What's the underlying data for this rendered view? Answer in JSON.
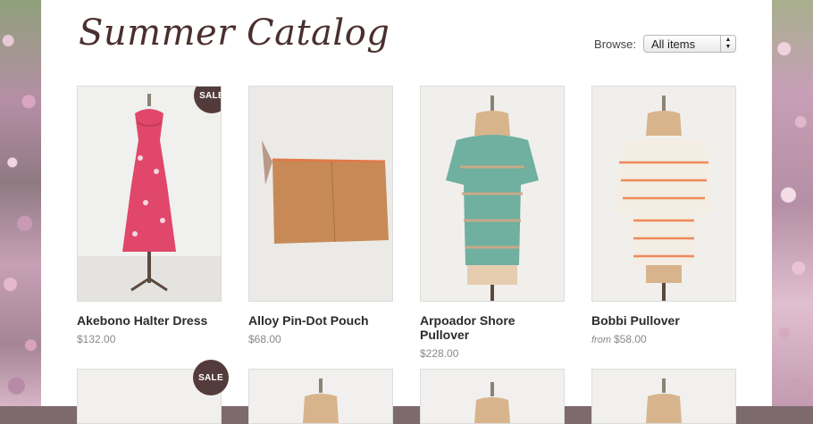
{
  "header": {
    "title": "Summer Catalog"
  },
  "browse": {
    "label": "Browse:",
    "selected": "All items"
  },
  "products": [
    {
      "name": "Akebono Halter Dress",
      "price": "$132.00",
      "from": "",
      "sale": "SALE",
      "icon": "dress-image"
    },
    {
      "name": "Alloy Pin-Dot Pouch",
      "price": "$68.00",
      "from": "",
      "sale": "",
      "icon": "pouch-image"
    },
    {
      "name": "Arpoador Shore Pullover",
      "price": "$228.00",
      "from": "",
      "sale": "",
      "icon": "pullover-image"
    },
    {
      "name": "Bobbi Pullover",
      "price": "$58.00",
      "from": "from",
      "sale": "",
      "icon": "striped-pullover-image"
    }
  ],
  "row2": [
    {
      "sale": "SALE"
    },
    {},
    {},
    {}
  ],
  "colors": {
    "badge": "#543b3b",
    "title": "#4a2f2f"
  }
}
